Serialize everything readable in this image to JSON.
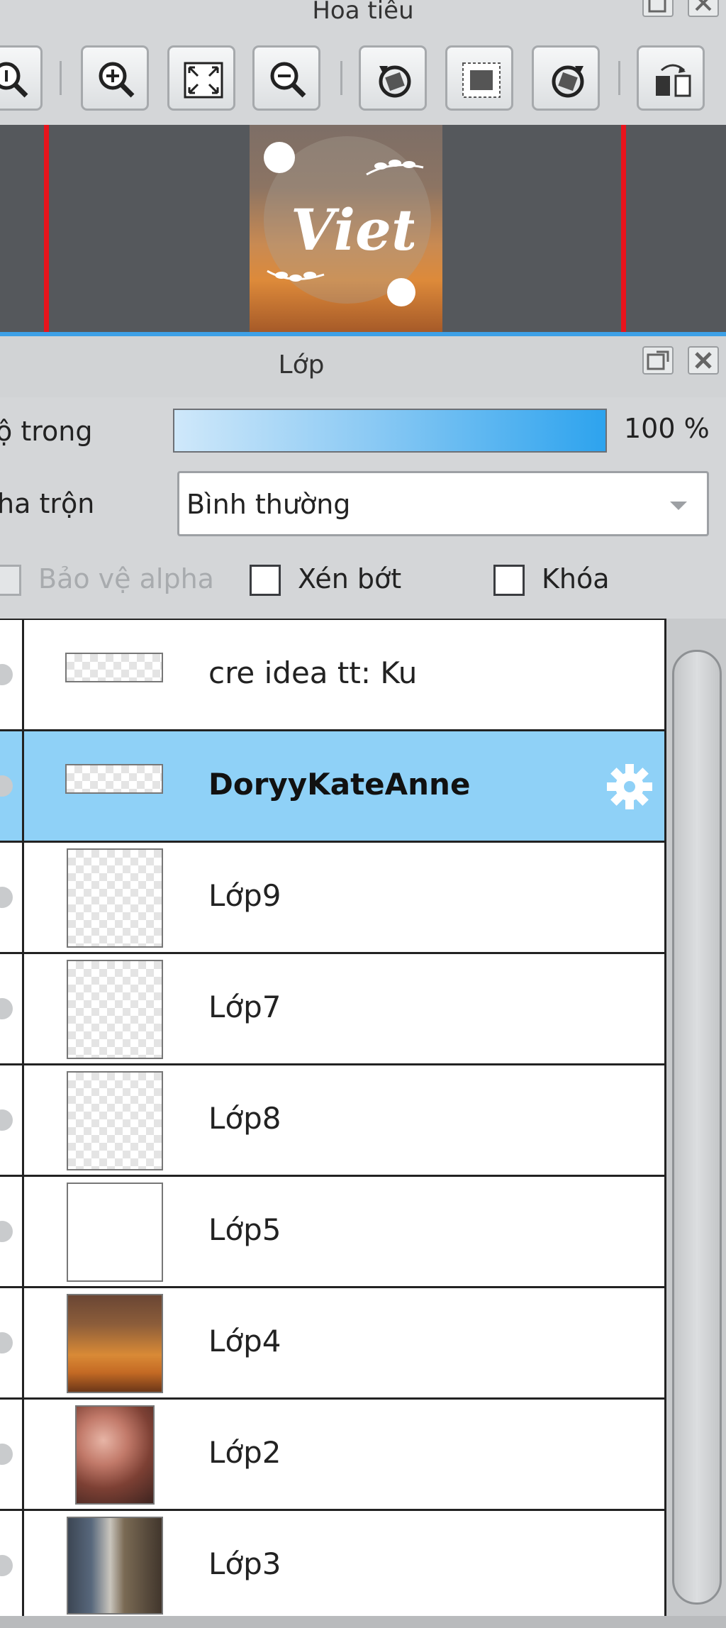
{
  "navigator": {
    "title": "Hoa tiêu",
    "toolbar_buttons": [
      {
        "name": "zoom-actual-icon"
      },
      {
        "name": "zoom-in-icon"
      },
      {
        "name": "fit-to-window-icon"
      },
      {
        "name": "zoom-out-icon"
      },
      {
        "name": "rotate-left-icon"
      },
      {
        "name": "reset-rotation-icon"
      },
      {
        "name": "rotate-right-icon"
      },
      {
        "name": "flip-horizontal-icon"
      }
    ],
    "preview_text": "Viet"
  },
  "layers_panel": {
    "title": "Lớp",
    "opacity_label": "ộ trong",
    "opacity_value": "100 %",
    "opacity_level": 1.0,
    "blend_label": "ha trộn",
    "blend_mode": "Bình thường",
    "protect_alpha_label": "Bảo vệ alpha",
    "clipping_label": "Xén bớt",
    "lock_label": "Khóa",
    "layers": [
      {
        "name": "cre idea tt: Ku",
        "thumb": "wide-transparent",
        "selected": false
      },
      {
        "name": "DoryyKateAnne",
        "thumb": "wide-transparent",
        "selected": true
      },
      {
        "name": "Lớp9",
        "thumb": "transparent",
        "selected": false
      },
      {
        "name": "Lớp7",
        "thumb": "transparent",
        "selected": false
      },
      {
        "name": "Lớp8",
        "thumb": "transparent",
        "selected": false
      },
      {
        "name": "Lớp5",
        "thumb": "white",
        "selected": false
      },
      {
        "name": "Lớp4",
        "thumb": "photo-sunset",
        "selected": false
      },
      {
        "name": "Lớp2",
        "thumb": "photo-flowers",
        "selected": false
      },
      {
        "name": "Lớp3",
        "thumb": "photo-tower",
        "selected": false
      }
    ]
  },
  "colors": {
    "selected_row": "#8fd1f7",
    "accent_blue": "#3da0e6",
    "red_guides": "#e8141c"
  }
}
